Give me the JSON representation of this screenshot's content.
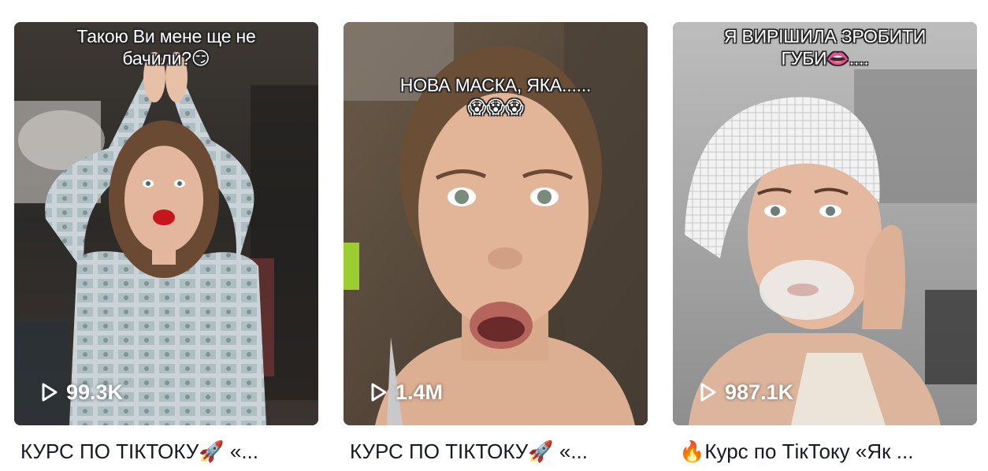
{
  "videos": [
    {
      "overlay_lines": [
        "Такою Ви мене ще не",
        "бачили?😏"
      ],
      "play_count": "99.3K",
      "caption": "КУРС ПО ТІКТОКУ🚀 «..."
    },
    {
      "overlay_lines": [
        "НОВА МАСКА, ЯКА......",
        "😱😱😱"
      ],
      "play_count": "1.4M",
      "caption": "КУРС ПО ТІКТОКУ🚀 «..."
    },
    {
      "overlay_lines": [
        "Я ВИРІШИЛА ЗРОБИТИ",
        "ГУБИ👄...."
      ],
      "play_count": "987.1K",
      "caption": "🔥Курс по ТікТоку «Як ..."
    }
  ],
  "icons": {
    "play": "play-outline-icon"
  },
  "colors": {
    "caption_text": "#161823",
    "overlay_text": "#ffffff"
  }
}
